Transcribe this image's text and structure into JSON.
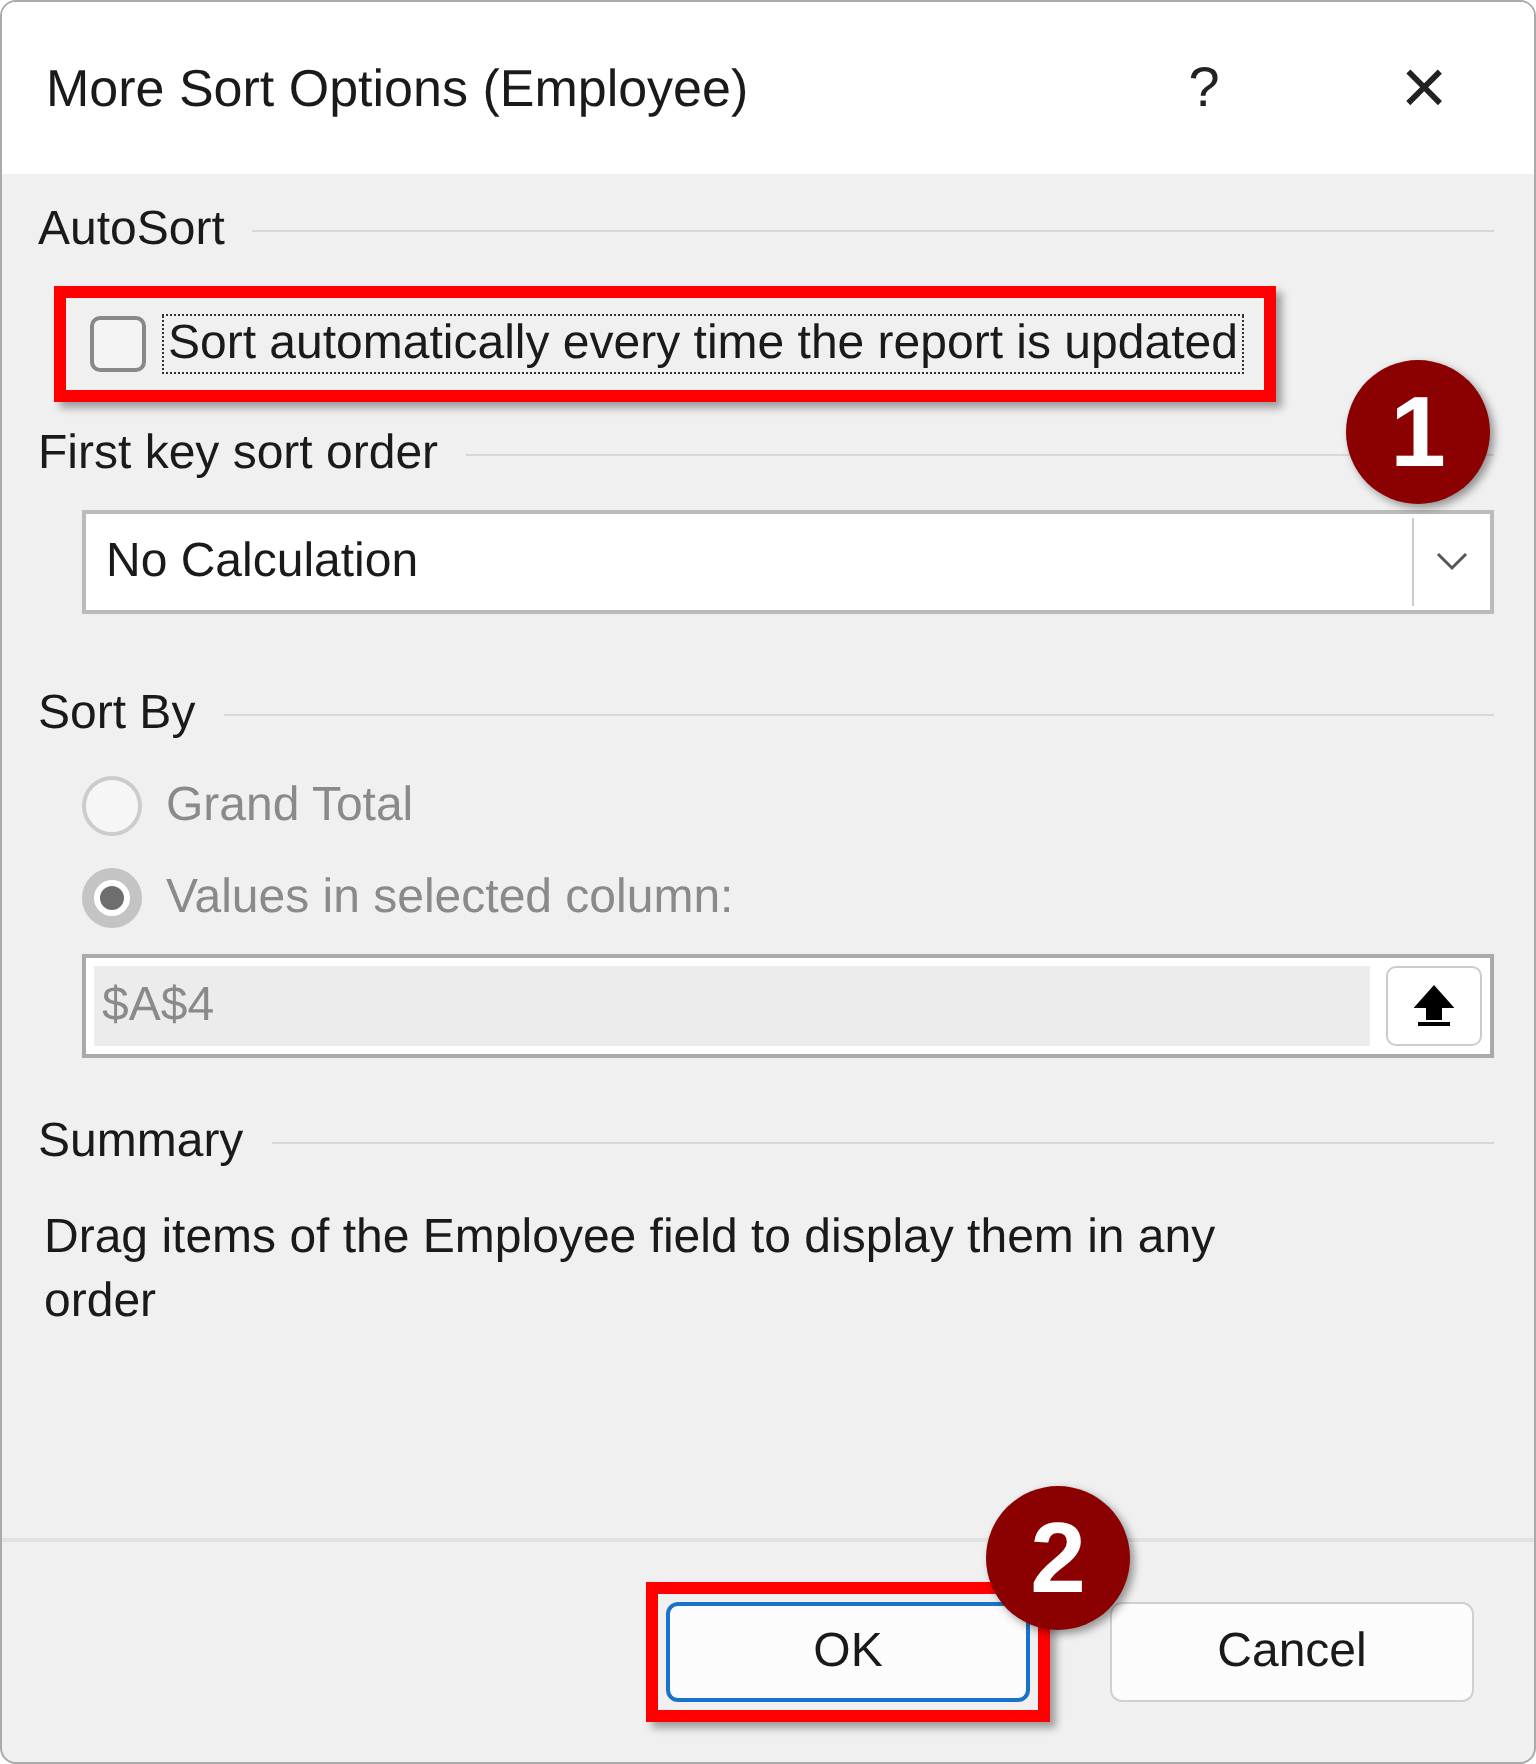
{
  "window": {
    "title": "More Sort Options (Employee)",
    "help_button": "?",
    "close_button": "×"
  },
  "autosort": {
    "heading": "AutoSort",
    "checkbox": {
      "label": "Sort automatically every time the report is updated",
      "checked": false,
      "highlighted": true
    }
  },
  "first_key": {
    "heading": "First key sort order",
    "value": "No Calculation"
  },
  "sort_by": {
    "heading": "Sort By",
    "options": [
      {
        "label": "Grand Total",
        "selected": false,
        "disabled": true
      },
      {
        "label": "Values in selected column:",
        "selected": true,
        "disabled": true
      }
    ],
    "reference": {
      "value": "$A$4",
      "disabled": true
    }
  },
  "summary": {
    "heading": "Summary",
    "text": "Drag items of the Employee field to display them in any order"
  },
  "buttons": [
    {
      "label": "OK",
      "default": true,
      "highlighted": true
    },
    {
      "label": "Cancel",
      "default": false,
      "highlighted": false
    }
  ],
  "annotations": [
    {
      "label": "1"
    },
    {
      "label": "2"
    }
  ]
}
